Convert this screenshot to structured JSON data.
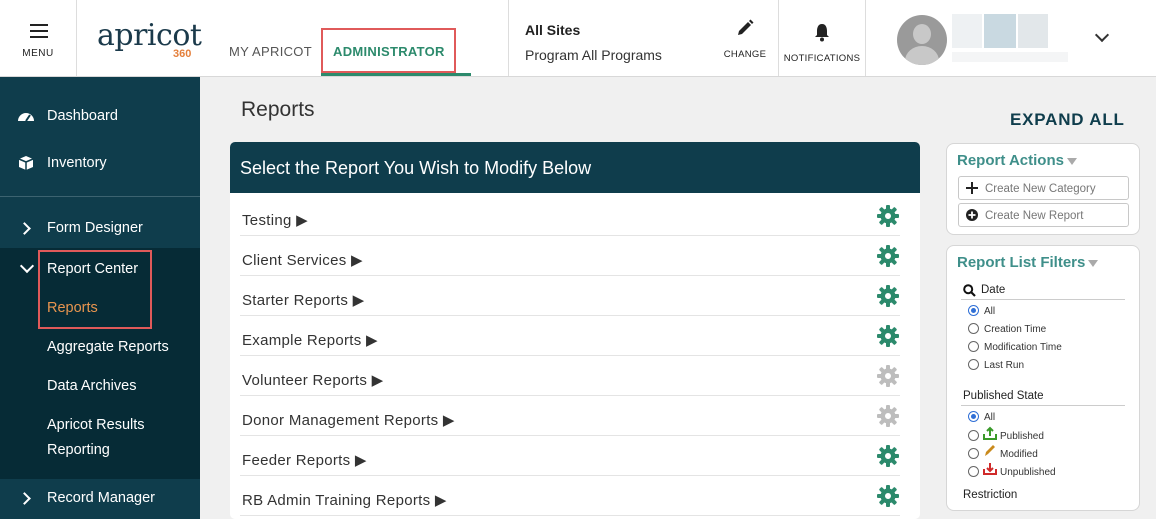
{
  "header": {
    "menu_label": "MENU",
    "logo_word": "apricot",
    "logo_number": "360",
    "tabs": [
      {
        "label": "MY APRICOT"
      },
      {
        "label": "ADMINISTRATOR"
      }
    ],
    "site_title": "All Sites",
    "program_label": "Program All Programs",
    "change_label": "CHANGE",
    "notifications_label": "NOTIFICATIONS",
    "accent_color": "#2c8a6c",
    "highlight_color": "#e05a5a"
  },
  "sidebar": {
    "items": [
      {
        "label": "Dashboard",
        "icon": "dashboard-icon"
      },
      {
        "label": "Inventory",
        "icon": "inventory-box-icon"
      },
      {
        "label": "Form Designer",
        "icon": "chevron-right-icon"
      },
      {
        "label": "Report Center",
        "icon": "chevron-down-icon"
      },
      {
        "label": "Record Manager",
        "icon": "chevron-right-icon"
      }
    ],
    "sub_items": [
      {
        "label": "Reports"
      },
      {
        "label": "Aggregate Reports"
      },
      {
        "label": "Data Archives"
      },
      {
        "label": "Apricot Results"
      },
      {
        "label": "Reporting"
      }
    ],
    "bg_color": "#0f3d4c",
    "active_color": "#e8954f"
  },
  "main": {
    "page_title": "Reports",
    "expand_all": "EXPAND ALL",
    "panel_title": "Select the Report You Wish to Modify Below",
    "reports": [
      {
        "name": "Testing ▶",
        "gear": "active"
      },
      {
        "name": "Client Services ▶",
        "gear": "active"
      },
      {
        "name": "Starter Reports ▶",
        "gear": "active"
      },
      {
        "name": "Example Reports ▶",
        "gear": "active"
      },
      {
        "name": "Volunteer Reports ▶",
        "gear": "inactive"
      },
      {
        "name": "Donor Management Reports ▶",
        "gear": "inactive"
      },
      {
        "name": "Feeder Reports ▶",
        "gear": "active"
      },
      {
        "name": "RB Admin Training Reports ▶",
        "gear": "active"
      }
    ],
    "gear_active_color": "#2c8a6c",
    "gear_inactive_color": "#bdbdbd"
  },
  "actions": {
    "title": "Report Actions",
    "create_category": "Create New Category",
    "create_report": "Create New Report"
  },
  "filters": {
    "title": "Report List Filters",
    "date_label": "Date",
    "date_options": [
      "All",
      "Creation Time",
      "Modification Time",
      "Last Run"
    ],
    "date_selected": "All",
    "published_label": "Published State",
    "published_options": [
      "All",
      "Published",
      "Modified",
      "Unpublished"
    ],
    "published_selected": "All",
    "restriction_label": "Restriction"
  }
}
